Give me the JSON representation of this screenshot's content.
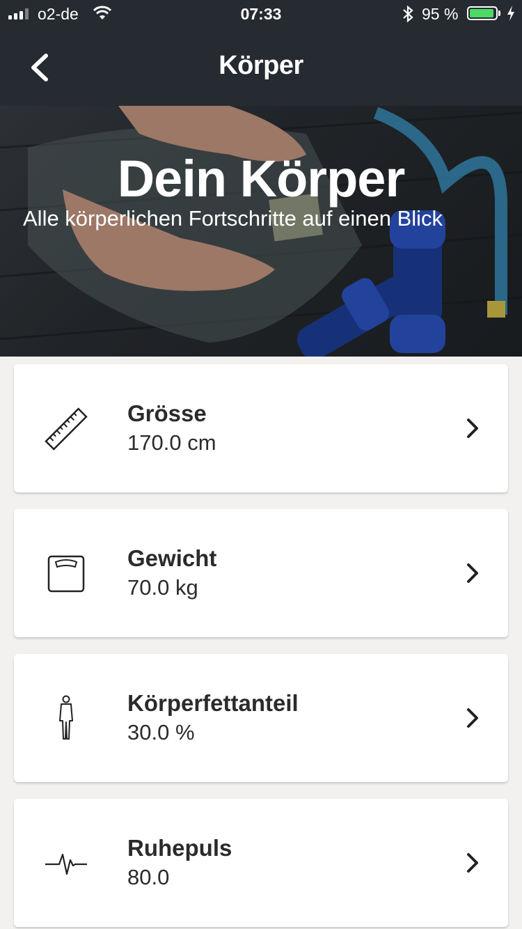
{
  "status_bar": {
    "carrier": "o2-de",
    "time": "07:33",
    "battery_percent": "95 %",
    "battery_level": 0.95
  },
  "nav": {
    "back_icon": "chevron-left-icon",
    "title": "Körper"
  },
  "hero": {
    "title": "Dein Körper",
    "subtitle": "Alle körperlichen Fortschritte auf einen Blick"
  },
  "items": [
    {
      "icon": "ruler-icon",
      "label": "Grösse",
      "value": "170.0 cm"
    },
    {
      "icon": "scale-icon",
      "label": "Gewicht",
      "value": "70.0 kg"
    },
    {
      "icon": "person-icon",
      "label": "Körperfettanteil",
      "value": "30.0 %"
    },
    {
      "icon": "heartbeat-icon",
      "label": "Ruhepuls",
      "value": "80.0"
    }
  ],
  "colors": {
    "nav_background": "#262b31",
    "battery_green": "#4cd964",
    "page_background": "#f2f1f0"
  }
}
